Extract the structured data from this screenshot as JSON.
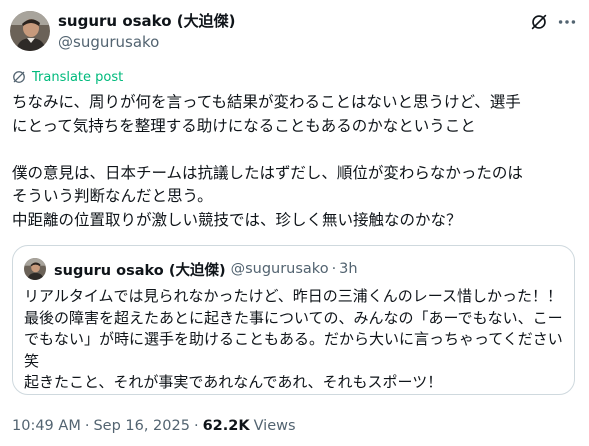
{
  "author": {
    "display_name": "suguru osako (大迫傑)",
    "handle": "@sugurusako"
  },
  "translate_label": "Translate post",
  "post_text": [
    "ちなみに、周りが何を言っても結果が変わることはないと思うけど、選手",
    "にとって気持ちを整理する助けになることもあるのかなということ",
    "",
    "僕の意見は、日本チームは抗議したはずだし、順位が変わらなかったのは",
    "そういう判断なんだと思う。",
    "中距離の位置取りが激しい競技では、珍しく無い接触なのかな？"
  ],
  "quoted_post": {
    "display_name": "suguru osako (大迫傑)",
    "handle": "@sugurusako",
    "separator": "·",
    "time": "3h",
    "text": [
      "リアルタイムでは見られなかったけど、昨日の三浦くんのレース惜しかった！！",
      "最後の障害を超えたあとに起きた事についての、みんなの「あーでもない、こー",
      "でもない」が時に選手を助けることもある。だから大いに言っちゃってください",
      "笑",
      "起きたこと、それが事実であれなんであれ、それもスポーツ！"
    ]
  },
  "footer": {
    "time": "10:49 AM",
    "separator": "·",
    "date": "Sep 16, 2025",
    "views_count": "62.2K",
    "views_label": "Views"
  },
  "icons": {
    "grok": "grok-icon",
    "more": "more-icon",
    "translate": "translate-icon"
  },
  "colors": {
    "text_primary": "#0f1419",
    "text_secondary": "#536471",
    "translate_green": "#00ba7c",
    "border": "#cfd9de"
  }
}
